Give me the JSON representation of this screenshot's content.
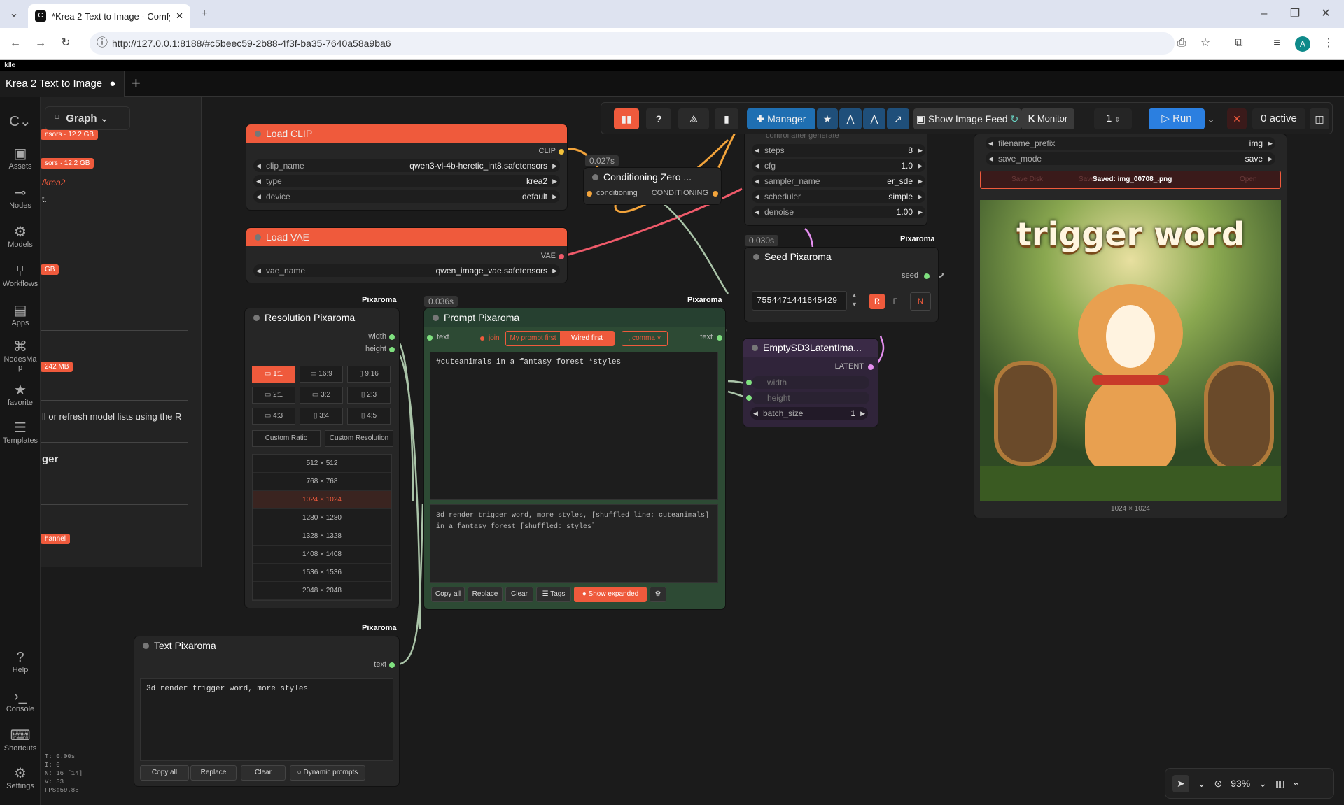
{
  "browser": {
    "tab_title": "*Krea 2 Text to Image - ComfyU",
    "url": "http://127.0.0.1:8188/#c5beec59-2b88-4f3f-ba35-7640a58a9ba6",
    "profile": "A"
  },
  "app": {
    "status": "Idle",
    "workflow_tab": "Krea 2 Text to Image",
    "graph_label": "Graph"
  },
  "sidebar": [
    "Assets",
    "Nodes",
    "Models",
    "Workflows",
    "Apps",
    "NodesMap",
    "favorite",
    "Templates",
    "Help",
    "Console",
    "Shortcuts",
    "Settings"
  ],
  "panel": {
    "badges": [
      "nsors · 12.2 GB",
      "sors · 12.2 GB",
      "GB",
      "242 MB",
      "hannel"
    ],
    "link": "/krea2",
    "text1": "t.",
    "text2": "ll or refresh model lists using the R",
    "text3": "ger"
  },
  "toolbar": {
    "manager": "Manager",
    "feed": "Show Image Feed",
    "monitor": "Monitor",
    "queue": "1",
    "run": "Run",
    "active": "0 active"
  },
  "load_clip": {
    "title": "Load CLIP",
    "out": "CLIP",
    "clip_name": "qwen3-vl-4b-heretic_int8.safetensors",
    "type": "krea2",
    "device": "default",
    "l1": "clip_name",
    "l2": "type",
    "l3": "device"
  },
  "load_vae": {
    "title": "Load VAE",
    "out": "VAE",
    "l": "vae_name",
    "v": "qwen_image_vae.safetensors"
  },
  "cond": {
    "timing": "0.027s",
    "title": "Conditioning Zero ...",
    "in": "conditioning",
    "out": "CONDITIONING"
  },
  "ksampler": {
    "faint": "control after generate",
    "rows": [
      [
        "steps",
        "8"
      ],
      [
        "cfg",
        "1.0"
      ],
      [
        "sampler_name",
        "er_sde"
      ],
      [
        "scheduler",
        "simple"
      ],
      [
        "denoise",
        "1.00"
      ]
    ]
  },
  "seed": {
    "timing": "0.030s",
    "title": "Seed Pixaroma",
    "out": "seed",
    "value": "755447144164542​9",
    "r": "R",
    "f": "F",
    "n": "N"
  },
  "latent": {
    "title": "EmptySD3LatentIma...",
    "out": "LATENT",
    "w": "width",
    "h": "height",
    "bl": "batch_size",
    "bv": "1"
  },
  "save": {
    "l1": "filename_prefix",
    "v1": "img",
    "l2": "save_mode",
    "v2": "save",
    "saved": "Saved: img_00708_.png",
    "b1": "Save Disk",
    "b2": "Save",
    "b3": "Open",
    "image_text": "trigger word",
    "dims": "1024 × 1024"
  },
  "resolution": {
    "title": "Resolution Pixaroma",
    "tag": "Pixaroma",
    "out1": "width",
    "out2": "height",
    "ratios": [
      "1:1",
      "16:9",
      "9:16",
      "2:1",
      "3:2",
      "2:3",
      "4:3",
      "3:4",
      "4:5"
    ],
    "custom1": "Custom Ratio",
    "custom2": "Custom Resolution",
    "sizes": [
      "512 × 512",
      "768 × 768",
      "1024 × 1024",
      "1280 × 1280",
      "1328 × 1328",
      "1408 × 1408",
      "1536 × 1536",
      "2048 × 2048"
    ]
  },
  "prompt": {
    "timing": "0.036s",
    "title": "Prompt Pixaroma",
    "tag": "Pixaroma",
    "in": "text",
    "join": "join",
    "m1": "My prompt first",
    "m2": "Wired first",
    "sep": ", comma",
    "out": "text",
    "text": "#cuteanimals in a fantasy forest *styles",
    "preview": "3d render trigger word, more styles, [shuffled line: cuteanimals] in a fantasy forest [shuffled: styles]",
    "b1": "Copy all",
    "b2": "Replace",
    "b3": "Clear",
    "b4": "Tags",
    "b5": "Show expanded"
  },
  "textnode": {
    "title": "Text Pixaroma",
    "tag": "Pixaroma",
    "out": "text",
    "text": "3d render trigger word, more styles",
    "b1": "Copy all",
    "b2": "Replace",
    "b3": "Clear",
    "b4": "Dynamic prompts"
  },
  "stats": {
    "t": "T: 0.00s",
    "i": "I: 0",
    "n": "N: 16 [14]",
    "v": "V: 33",
    "fps": "FPS:59.88"
  },
  "zoom": "93%",
  "colors": {
    "accent": "#ef5a3c",
    "run": "#2b7fe0",
    "manager": "#1f6fb2",
    "prompt_bg": "#2d4a34"
  }
}
